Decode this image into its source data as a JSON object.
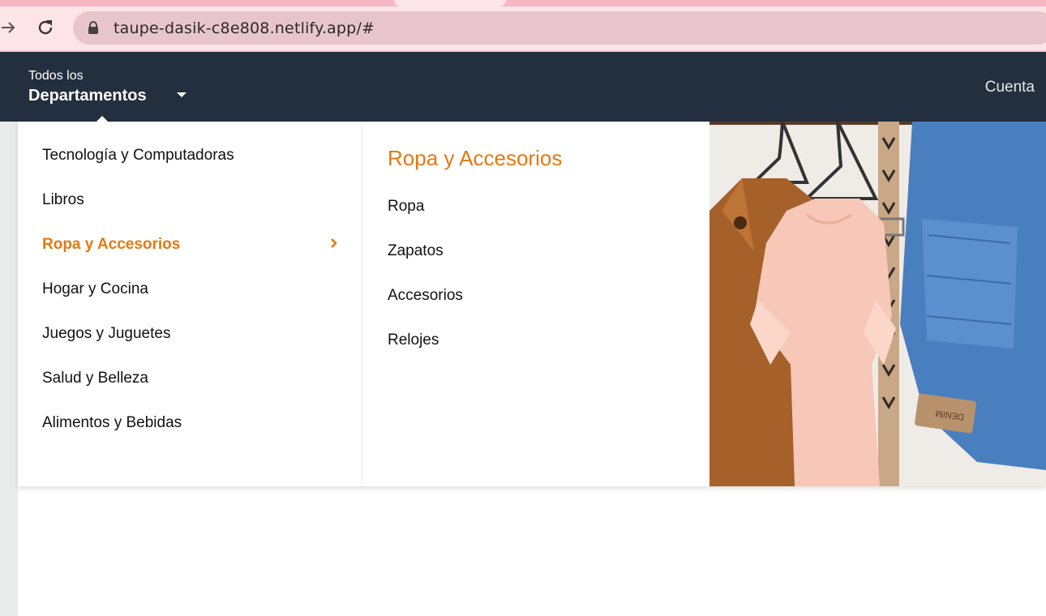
{
  "browser": {
    "url": "taupe-dasik-c8e808.netlify.app/#"
  },
  "header": {
    "dept_small": "Todos los",
    "dept_big": "Departamentos",
    "account": "Cuenta"
  },
  "menu": {
    "departments": [
      {
        "label": "Tecnología y Computadoras"
      },
      {
        "label": "Libros"
      },
      {
        "label": "Ropa y Accesorios"
      },
      {
        "label": "Hogar y Cocina"
      },
      {
        "label": "Juegos y Juguetes"
      },
      {
        "label": "Salud y Belleza"
      },
      {
        "label": "Alimentos y Bebidas"
      }
    ],
    "active_department": "Ropa y Accesorios",
    "submenu_title": "Ropa y Accesorios",
    "submenu": [
      {
        "label": "Ropa"
      },
      {
        "label": "Zapatos"
      },
      {
        "label": "Accesorios"
      },
      {
        "label": "Relojes"
      }
    ],
    "image_label": "DENIM"
  },
  "colors": {
    "header_bg": "#232f3e",
    "accent": "#e47911",
    "browser_toolbar": "#fde4e8",
    "omnibox": "#e8c5cc"
  },
  "icons": [
    "forward-arrow-icon",
    "reload-icon",
    "lock-icon",
    "caret-down-icon",
    "chevron-right-icon"
  ]
}
